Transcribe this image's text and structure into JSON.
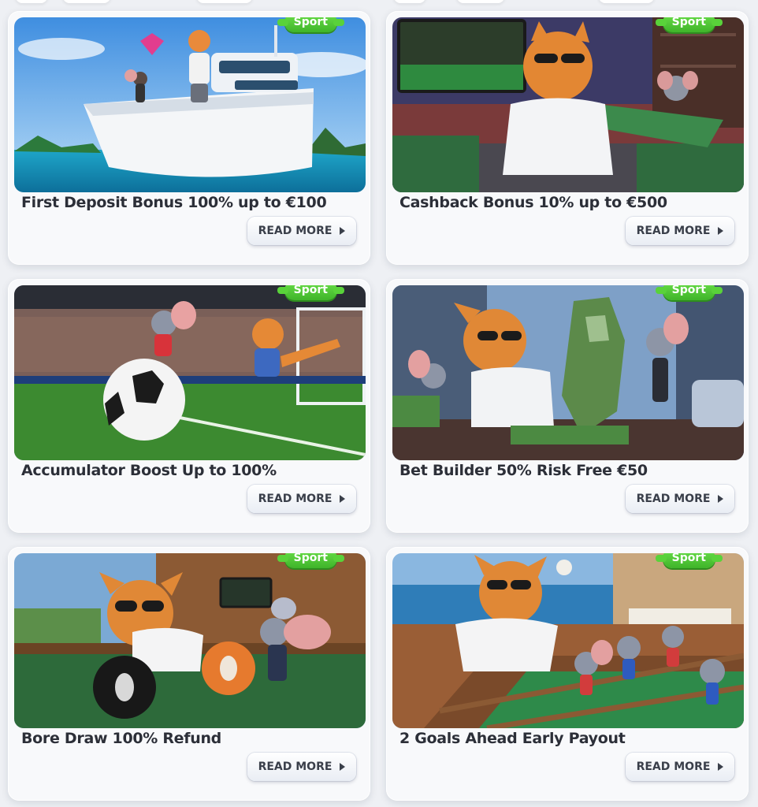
{
  "promotions": [
    {
      "title": "First Deposit Bonus 100% up to €100",
      "tag": "Sport",
      "button": "READ MORE",
      "image": "cat-on-yacht-illustration"
    },
    {
      "title": "Cashback Bonus 10% up to €500",
      "tag": "Sport",
      "button": "READ MORE",
      "image": "cat-with-money-illustration"
    },
    {
      "title": "Accumulator Boost Up to 100%",
      "tag": "Sport",
      "button": "READ MORE",
      "image": "cat-mouse-football-illustration"
    },
    {
      "title": "Bet Builder 50% Risk Free €50",
      "tag": "Sport",
      "button": "READ MORE",
      "image": "cat-money-sculpture-illustration"
    },
    {
      "title": "Bore Draw 100% Refund",
      "tag": "Sport",
      "button": "READ MORE",
      "image": "cat-billiards-illustration"
    },
    {
      "title": "2 Goals Ahead Early Payout",
      "tag": "Sport",
      "button": "READ MORE",
      "image": "cat-foosball-illustration"
    }
  ],
  "colors": {
    "tag_green": "#4cc836",
    "card_bg": "#f8f9fb",
    "title_text": "#2c2f38",
    "page_bg": "#eef0f4"
  }
}
